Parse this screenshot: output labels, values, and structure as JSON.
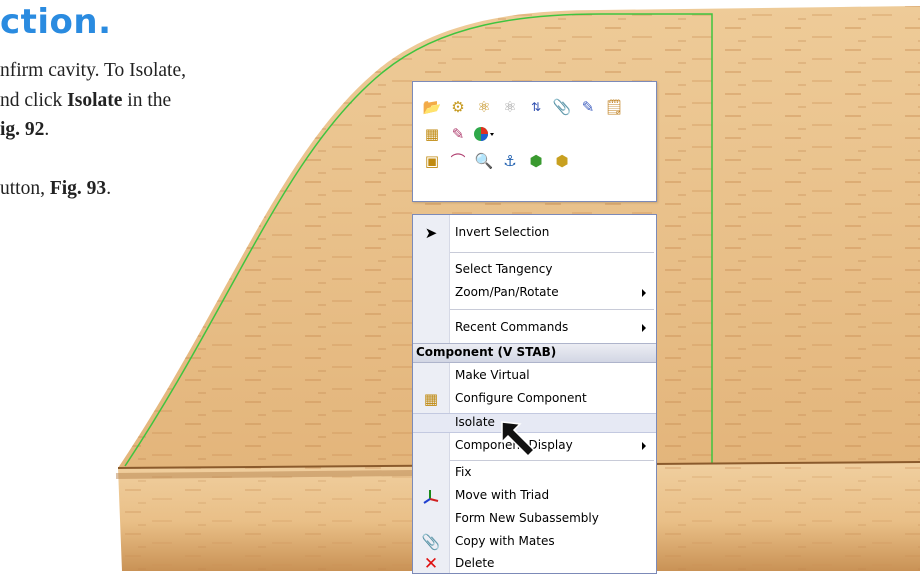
{
  "document": {
    "heading": "ction.",
    "lines": [
      "nfirm cavity.  To Isolate,",
      "nd click Isolate in the",
      "ig. 92."
    ],
    "line2_prefix": "nd click ",
    "line2_bold": "Isolate",
    "line2_suffix": " in the",
    "line3_bold": "ig. 92",
    "line3_suffix": ".",
    "line4_prefix": "utton, ",
    "line4_bold": "Fig. 93",
    "line4_suffix": "."
  },
  "toolbar": {
    "row0": [
      "open-part-icon",
      "edit-part-icon",
      "assembly-icon",
      "component-icon",
      "hide-show-icon",
      "paperclip-icon",
      "sketch-icon",
      "properties-icon"
    ],
    "row1": [
      "configure-icon",
      "edit-sketch-icon",
      "appearance-icon"
    ],
    "row2": [
      "select-icon",
      "sketch-line-icon",
      "zoom-selection-icon",
      "normal-to-icon",
      "view-icon",
      "isolate-view-icon"
    ]
  },
  "menu": {
    "items": [
      {
        "label": "Invert Selection"
      },
      {
        "label": "Select Tangency"
      },
      {
        "label": "Zoom/Pan/Rotate"
      },
      {
        "label": "Recent Commands"
      },
      {
        "label": "Make Virtual"
      },
      {
        "label": "Configure Component"
      },
      {
        "label": "Isolate"
      },
      {
        "label": "Component Display"
      },
      {
        "label": "Fix"
      },
      {
        "label": "Move with Triad"
      },
      {
        "label": "Form New Subassembly"
      },
      {
        "label": "Copy with Mates"
      },
      {
        "label": "Delete"
      }
    ],
    "section_header": "Component (V STAB)"
  },
  "colors": {
    "heading": "#2a8be0",
    "wood": "#e9c08a",
    "fin_outline": "#3fc43f",
    "menu_border": "#7c8ab8"
  }
}
